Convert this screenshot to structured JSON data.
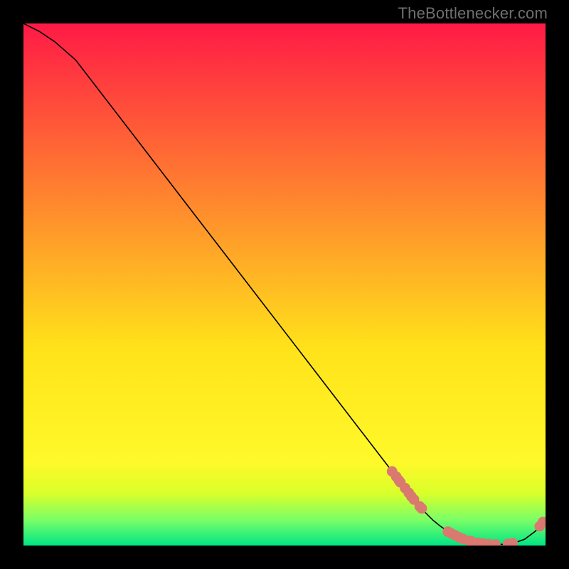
{
  "watermark": "TheBottlenecker.com",
  "chart_data": {
    "type": "line",
    "title": "",
    "xlabel": "",
    "ylabel": "",
    "xlim": [
      0,
      100
    ],
    "ylim": [
      0,
      100
    ],
    "grid": false,
    "legend": false,
    "background_gradient": {
      "top": "#ff1a46",
      "mid_upper": "#ff8a2d",
      "mid": "#ffe21a",
      "mid_lower": "#d9ff2a",
      "bottom_band_top": "#7cff66",
      "bottom": "#00e585"
    },
    "series": [
      {
        "name": "bottleneck-curve",
        "x": [
          0.0,
          1.0,
          3.0,
          6.0,
          10.0,
          20.0,
          30.0,
          40.0,
          50.0,
          60.0,
          70.0,
          72.0,
          73.0,
          74.0,
          75.0,
          77.0,
          78.5,
          80.0,
          82.0,
          84.0,
          86.0,
          88.0,
          90.0,
          92.0,
          94.0,
          96.0,
          98.0,
          99.0,
          100.0
        ],
        "y": [
          100.0,
          99.5,
          98.5,
          96.5,
          93.0,
          80.0,
          67.0,
          54.0,
          41.0,
          28.0,
          15.0,
          12.4,
          11.1,
          9.8,
          8.6,
          6.3,
          4.8,
          3.6,
          2.3,
          1.3,
          0.7,
          0.35,
          0.2,
          0.25,
          0.5,
          1.2,
          2.7,
          3.8,
          5.2
        ]
      }
    ],
    "markers": {
      "name": "curve-dots",
      "color": "#d9796f",
      "radius": 7.4,
      "points": [
        {
          "x": 70.6,
          "y": 14.2
        },
        {
          "x": 71.4,
          "y": 13.2
        },
        {
          "x": 71.9,
          "y": 12.5
        },
        {
          "x": 72.2,
          "y": 12.1
        },
        {
          "x": 73.1,
          "y": 11.0
        },
        {
          "x": 73.8,
          "y": 10.1
        },
        {
          "x": 74.3,
          "y": 9.4
        },
        {
          "x": 74.8,
          "y": 8.8
        },
        {
          "x": 75.9,
          "y": 7.5
        },
        {
          "x": 76.3,
          "y": 7.1
        },
        {
          "x": 81.3,
          "y": 2.65
        },
        {
          "x": 82.0,
          "y": 2.3
        },
        {
          "x": 82.7,
          "y": 1.95
        },
        {
          "x": 83.5,
          "y": 1.55
        },
        {
          "x": 84.2,
          "y": 1.25
        },
        {
          "x": 85.4,
          "y": 0.9
        },
        {
          "x": 85.8,
          "y": 0.8
        },
        {
          "x": 87.0,
          "y": 0.5
        },
        {
          "x": 87.7,
          "y": 0.4
        },
        {
          "x": 88.1,
          "y": 0.37
        },
        {
          "x": 89.2,
          "y": 0.25
        },
        {
          "x": 90.4,
          "y": 0.2
        },
        {
          "x": 92.8,
          "y": 0.3
        },
        {
          "x": 93.7,
          "y": 0.45
        },
        {
          "x": 98.9,
          "y": 3.7
        },
        {
          "x": 99.5,
          "y": 4.5
        }
      ]
    }
  }
}
